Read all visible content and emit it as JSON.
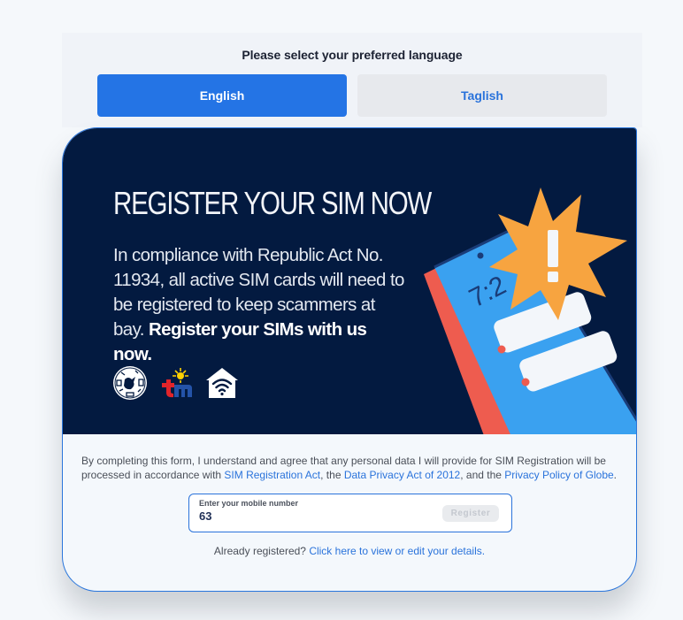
{
  "language": {
    "prompt": "Please select your preferred language",
    "options": [
      {
        "label": "English",
        "selected": true
      },
      {
        "label": "Taglish",
        "selected": false
      }
    ]
  },
  "banner": {
    "title": "REGISTER YOUR SIM NOW",
    "body_regular": "In compliance with Republic Act No. 11934, all active SIM cards will need to be registered to keep scammers at bay.",
    "body_bold": "Register your SIMs with us now.",
    "logos": [
      "globe-logo",
      "tm-logo",
      "home-wifi-logo"
    ],
    "illustration": {
      "phone_time": "7:2",
      "alert_symbol": "!"
    }
  },
  "consent": {
    "text_1": "By completing this form, I understand and agree that any personal data I will provide for SIM Registration will be processed in accordance with ",
    "link_1": "SIM Registration Act",
    "text_2": ", the ",
    "link_2": "Data Privacy Act of 2012",
    "text_3": ", and the ",
    "link_3": "Privacy Policy of Globe",
    "text_4": "."
  },
  "mobile": {
    "label": "Enter your mobile number",
    "value": "63",
    "register_label": "Register"
  },
  "already": {
    "text": "Already registered? ",
    "link": "Click here to view or edit your details."
  },
  "colors": {
    "primary": "#2474e5",
    "banner_bg": "#031a40",
    "link": "#2a73db"
  }
}
